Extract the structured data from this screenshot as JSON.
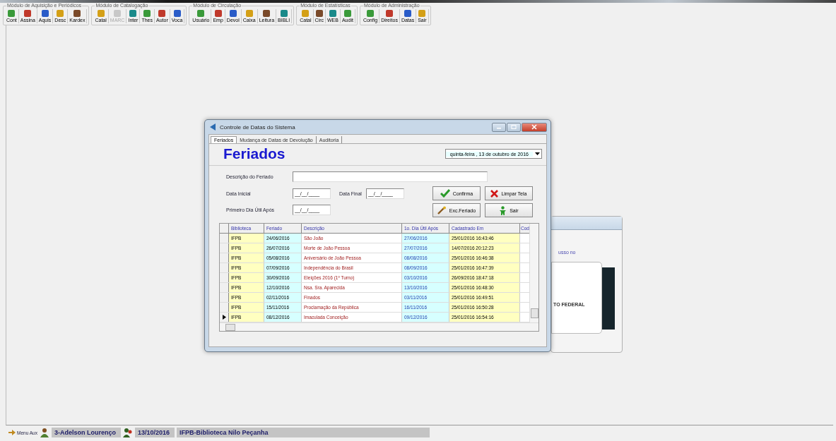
{
  "toolbar": {
    "groups": [
      {
        "title": "Módulo de Aquisição e Periódicos",
        "buttons": [
          {
            "label": "Cont",
            "disabled": false
          },
          {
            "label": "Assina",
            "disabled": false
          },
          {
            "label": "Aquis",
            "disabled": false
          },
          {
            "label": "Desc",
            "disabled": false
          },
          {
            "label": "Kardex",
            "disabled": false
          }
        ]
      },
      {
        "title": "Módulo de Catalogação",
        "buttons": [
          {
            "label": "Catal",
            "disabled": false
          },
          {
            "label": "MARC",
            "disabled": true
          },
          {
            "label": "Inter",
            "disabled": false
          },
          {
            "label": "Thes",
            "disabled": false
          },
          {
            "label": "Autor",
            "disabled": false
          },
          {
            "label": "Voca",
            "disabled": false
          }
        ]
      },
      {
        "title": "Módulo de Circulação",
        "buttons": [
          {
            "label": "Usuário",
            "disabled": false
          },
          {
            "label": "Emp",
            "disabled": false
          },
          {
            "label": "Devol",
            "disabled": false
          },
          {
            "label": "Caixa",
            "disabled": false
          },
          {
            "label": "Leitura",
            "disabled": false
          },
          {
            "label": "BIBLI",
            "disabled": false
          }
        ]
      },
      {
        "title": "Módulo de Estatísticas",
        "buttons": [
          {
            "label": "Catal",
            "disabled": false
          },
          {
            "label": "Circ",
            "disabled": false
          },
          {
            "label": "WEB",
            "disabled": false
          },
          {
            "label": "Audit",
            "disabled": false
          }
        ]
      },
      {
        "title": "Módulo de Administração",
        "buttons": [
          {
            "label": "Config",
            "disabled": false
          },
          {
            "label": "Direitos",
            "disabled": false
          },
          {
            "label": "Datas",
            "disabled": false
          },
          {
            "label": "Sair",
            "disabled": false
          }
        ]
      }
    ]
  },
  "background_window": {
    "texts": [
      "usso no",
      "TO FEDERAL"
    ]
  },
  "dialog": {
    "title": "Controle de Datas do Sistema",
    "tabs": [
      {
        "label": "Feriados",
        "selected": true
      },
      {
        "label": "Mudança de Datas de Devolução",
        "selected": false
      },
      {
        "label": "Auditoria",
        "selected": false
      }
    ],
    "heading": "Feriados",
    "date_picker": {
      "value": "quinta-feira , 13 de  outubro  de 2016"
    },
    "description_field": {
      "label": "Descrição do Feriado"
    },
    "start_date": {
      "label": "Data Inicial",
      "value": "__/__/____"
    },
    "end_date": {
      "label": "Data Final",
      "value": "__/__/____"
    },
    "first_workday": {
      "label": "Primeiro Dia Útil Após",
      "value": "__/__/____"
    },
    "buttons": [
      {
        "label": "Confirma",
        "kind": "confirm"
      },
      {
        "label": "Limpar Tela",
        "kind": "clear"
      },
      {
        "label": "Exc.Feriado",
        "kind": "delete"
      },
      {
        "label": "Sair",
        "kind": "exit"
      }
    ],
    "table": {
      "columns": [
        "Biblioteca",
        "Feriado",
        "Descrição",
        "1o. Dia Útil Após",
        "Cadastrado Em",
        "Cod"
      ],
      "rows": [
        {
          "cells": [
            "IFPB",
            "24/06/2016",
            "São João",
            "27/06/2016",
            "25/01/2016 16:43:46"
          ],
          "current": false
        },
        {
          "cells": [
            "IFPB",
            "26/07/2016",
            "Morte de João Pessoa",
            "27/07/2016",
            "14/07/2016 20:12:23"
          ],
          "current": false
        },
        {
          "cells": [
            "IFPB",
            "05/08/2016",
            "Aniversário de João Pessoa",
            "08/08/2016",
            "25/01/2016 16:46:38"
          ],
          "current": false
        },
        {
          "cells": [
            "IFPB",
            "07/09/2016",
            "Independência do Brasil",
            "08/09/2016",
            "25/01/2016 16:47:39"
          ],
          "current": false
        },
        {
          "cells": [
            "IFPB",
            "30/09/2016",
            "Eleições 2016 (1º Turno)",
            "03/10/2016",
            "26/09/2016 18:47:18"
          ],
          "current": false
        },
        {
          "cells": [
            "IFPB",
            "12/10/2016",
            "Nsa. Sra. Aparecida",
            "13/10/2016",
            "25/01/2016 16:48:30"
          ],
          "current": false
        },
        {
          "cells": [
            "IFPB",
            "02/11/2016",
            "Finados",
            "03/11/2016",
            "25/01/2016 16:49:51"
          ],
          "current": false
        },
        {
          "cells": [
            "IFPB",
            "15/11/2016",
            "Proclamação da República",
            "16/11/2016",
            "25/01/2016 16:50:28"
          ],
          "current": false
        },
        {
          "cells": [
            "IFPB",
            "08/12/2016",
            "Imaculada Conceição",
            "09/12/2016",
            "25/01/2016 16:54:16"
          ],
          "current": true
        }
      ]
    }
  },
  "status_bar": {
    "menu_label": "Menu Aux",
    "user": "3-Adelson Lourenço",
    "date": "13/10/2016",
    "library": "IFPB-Biblioteca Nilo Peçanha"
  }
}
